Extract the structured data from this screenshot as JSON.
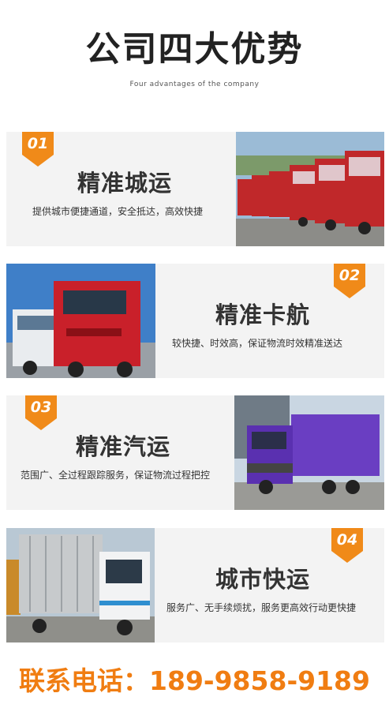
{
  "header": {
    "title": "公司四大优势",
    "subtitle": "Four advantages of the company"
  },
  "advantages": [
    {
      "number": "01",
      "title": "精准城运",
      "description": "提供城市便捷通道，安全抵达，高效快捷",
      "image": "row-of-red-trucks-photo"
    },
    {
      "number": "02",
      "title": "精准卡航",
      "description": "较快捷、时效高，保证物流时效精准送达",
      "image": "red-and-white-trucks-photo"
    },
    {
      "number": "03",
      "title": "精准汽运",
      "description": "范围广、全过程跟踪服务，保证物流过程把控",
      "image": "purple-box-truck-photo"
    },
    {
      "number": "04",
      "title": "城市快运",
      "description": "服务广、无手续烦扰，服务更高效行动更快捷",
      "image": "white-cargo-truck-photo"
    }
  ],
  "contact": {
    "label": "联系电话：",
    "phone": "189-9858-9189"
  },
  "colors": {
    "accent": "#f08a19",
    "contact": "#f07d12",
    "card_bg": "#f3f3f3"
  }
}
